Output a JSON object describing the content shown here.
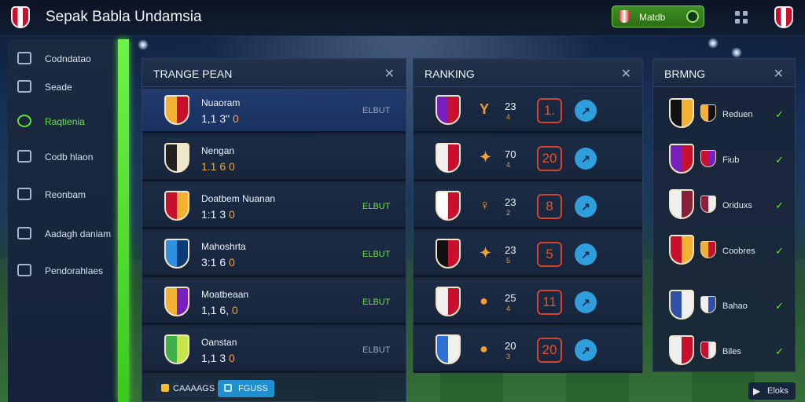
{
  "app": {
    "title": "Sepak Babla Undamsia"
  },
  "topbar": {
    "match_label": "Matdb"
  },
  "sidebar": {
    "items": [
      {
        "label": "Codndatao",
        "icon": "shield-outline-icon"
      },
      {
        "label": "Seade",
        "icon": "chart-bars-icon"
      },
      {
        "label": "Raqtienia",
        "icon": "ball-icon",
        "active": true
      },
      {
        "label": "Codb hlaon",
        "icon": "cup-icon"
      },
      {
        "label": "Reonbam",
        "icon": "players-icon"
      },
      {
        "label": "Aadagh daniam",
        "icon": "stadium-icon"
      },
      {
        "label": "Pendorahlaes",
        "icon": "flag-icon"
      }
    ]
  },
  "teams_panel": {
    "title": "TRANGE PEAN",
    "rows": [
      {
        "name": "Nuaoram",
        "score_a": "1,1 3\"",
        "score_b": "0",
        "ctrl": "ELBUT",
        "ctrl_green": false,
        "colors": [
          "#f2b130",
          "#c8102e"
        ],
        "selected": true
      },
      {
        "name": "Nengan",
        "score_a": "1.1 6",
        "score_b": "0",
        "ctrl": "",
        "ctrl_green": false,
        "colors": [
          "#222222",
          "#f0e6c8"
        ],
        "score_hi": true
      },
      {
        "name": "Doatbem Nuanan",
        "score_a": "1:1 3",
        "score_b": "0",
        "ctrl": "ELBUT",
        "ctrl_green": true,
        "colors": [
          "#c8102e",
          "#f2b130"
        ]
      },
      {
        "name": "Mahoshrta",
        "score_a": "3:1 6",
        "score_b": "0",
        "ctrl": "ELBUT",
        "ctrl_green": true,
        "colors": [
          "#2f8fe0",
          "#0d3a78"
        ]
      },
      {
        "name": "Moatbeaan",
        "score_a": "1,1 6,",
        "score_b": "0",
        "ctrl": "ELBUT",
        "ctrl_green": true,
        "colors": [
          "#f2b130",
          "#7a1fbf"
        ]
      },
      {
        "name": "Oanstan",
        "score_a": "1,1 3",
        "score_b": "0",
        "ctrl": "ELBUT",
        "ctrl_green": false,
        "colors": [
          "#3db04a",
          "#c9e34a"
        ]
      }
    ],
    "footer_left": "CAAAAGS",
    "footer_right": "FGUSS"
  },
  "ranking_panel": {
    "title": "RANKING",
    "rows": [
      {
        "glyph": "Y",
        "points": "23",
        "sub": "4",
        "rank": "1.",
        "colors": [
          "#7a1fbf",
          "#c8102e"
        ]
      },
      {
        "glyph": "✦",
        "points": "70",
        "sub": "4",
        "rank": "20",
        "colors": [
          "#f0f0f0",
          "#c8102e"
        ]
      },
      {
        "glyph": "♀",
        "points": "23",
        "sub": "2",
        "rank": "8",
        "colors": [
          "#ffffff",
          "#c8102e"
        ]
      },
      {
        "glyph": "✦",
        "points": "23",
        "sub": "5",
        "rank": "5",
        "colors": [
          "#111111",
          "#c8102e"
        ]
      },
      {
        "glyph": "●",
        "points": "25",
        "sub": "4",
        "rank": "11",
        "colors": [
          "#f0f0f0",
          "#c8102e"
        ]
      },
      {
        "glyph": "●",
        "points": "20",
        "sub": "3",
        "rank": "20",
        "colors": [
          "#2f6fd8",
          "#f0f0f0"
        ]
      }
    ]
  },
  "third_panel": {
    "title": "BRMNG",
    "rows": [
      {
        "label": "Reduen",
        "colors": [
          "#111111",
          "#f2b130"
        ]
      },
      {
        "label": "Fiub",
        "colors": [
          "#7a1fbf",
          "#c8102e"
        ]
      },
      {
        "label": "Oriduxs",
        "colors": [
          "#f0f0f0",
          "#8a1f3a"
        ]
      },
      {
        "label": "Coobres",
        "colors": [
          "#c8102e",
          "#f2b130"
        ]
      },
      {
        "label": "Bahao",
        "colors": [
          "#2f4fa8",
          "#f0f0f0"
        ]
      },
      {
        "label": "Biles",
        "colors": [
          "#f0f0f0",
          "#c8102e"
        ]
      }
    ]
  },
  "footer": {
    "next_label": "Eloks"
  }
}
